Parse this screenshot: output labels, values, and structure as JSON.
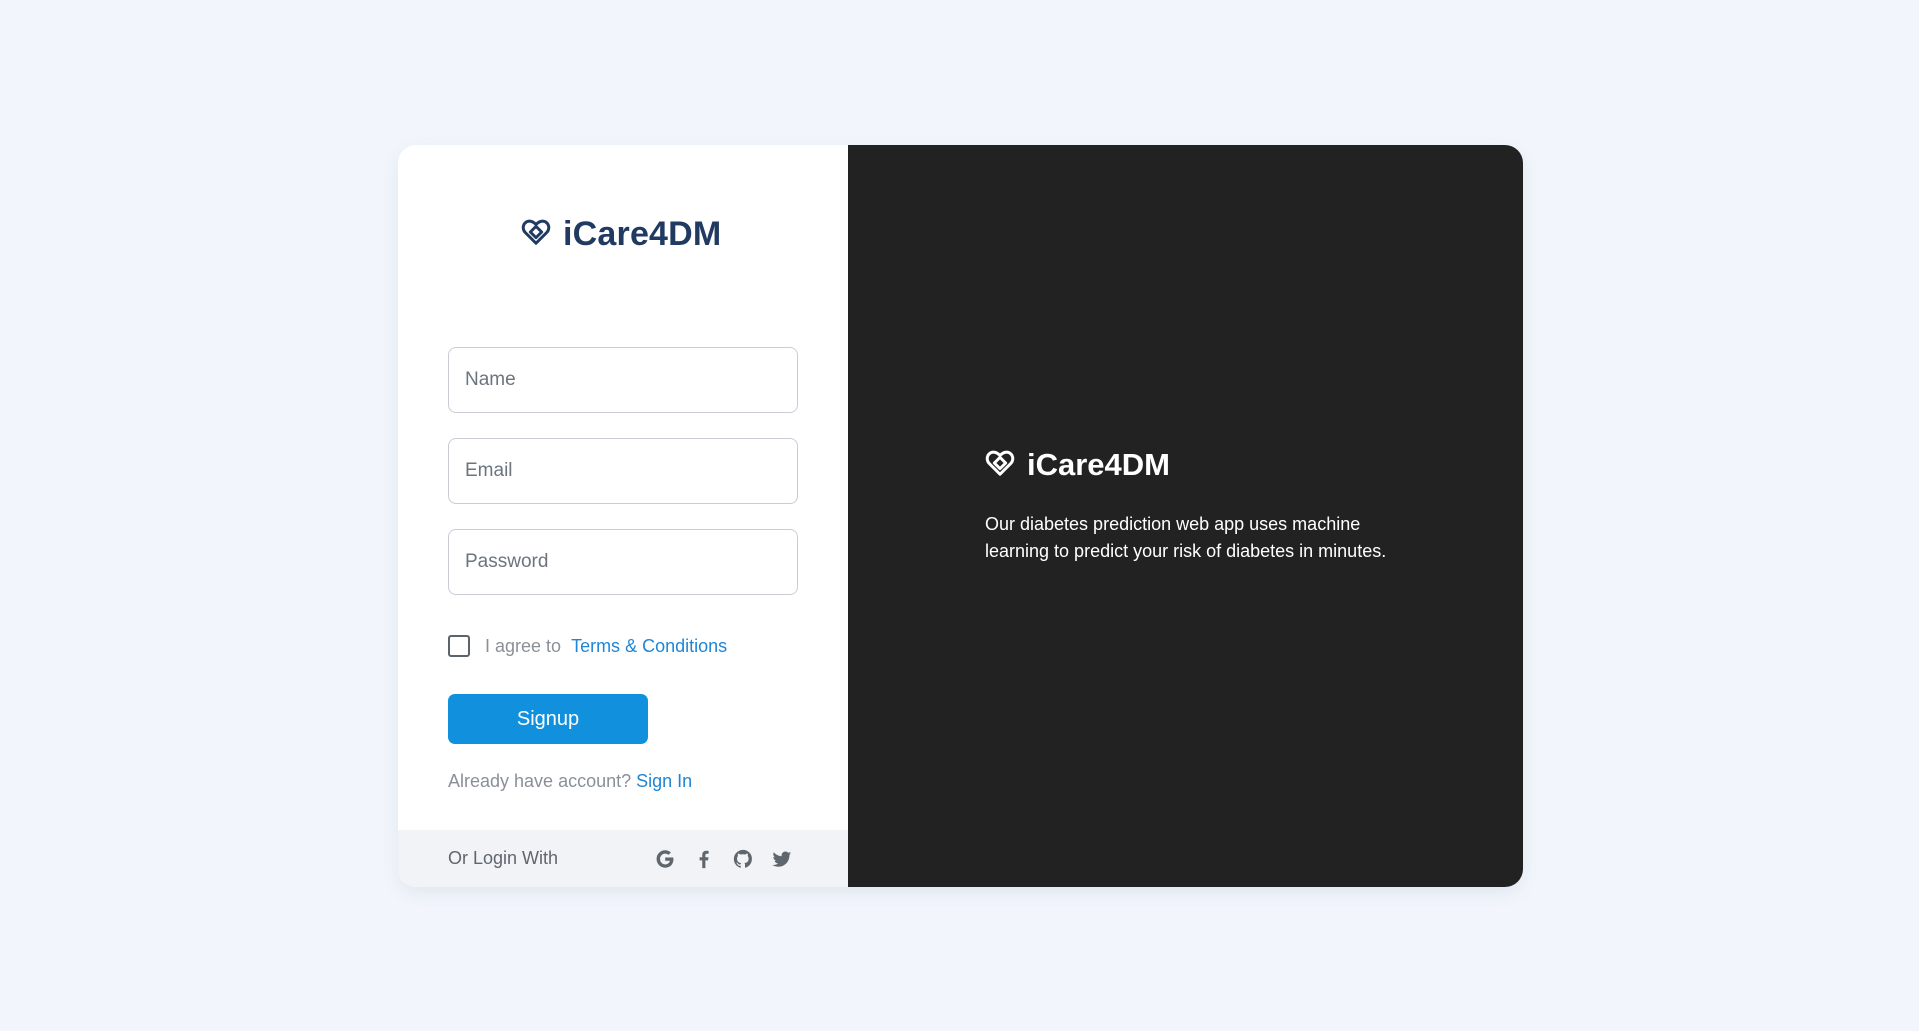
{
  "brand": {
    "name": "iCare4DM",
    "icon": "heart-diamond-icon"
  },
  "form": {
    "name_placeholder": "Name",
    "email_placeholder": "Email",
    "password_placeholder": "Password",
    "agree_prefix": "I agree to",
    "terms_link": "Terms & Conditions",
    "signup_label": "Signup",
    "have_account_text": "Already have account?",
    "signin_link": "Sign In"
  },
  "footer": {
    "label": "Or Login With",
    "socials": [
      "google-icon",
      "facebook-icon",
      "github-icon",
      "twitter-icon"
    ]
  },
  "promo": {
    "title": "iCare4DM",
    "description": "Our diabetes prediction web app uses machine learning to predict your risk of diabetes in minutes."
  },
  "colors": {
    "background": "#f2f6fc",
    "brand_dark": "#213a62",
    "accent": "#1190de",
    "link": "#1f86d6",
    "panel_dark": "#222222"
  }
}
